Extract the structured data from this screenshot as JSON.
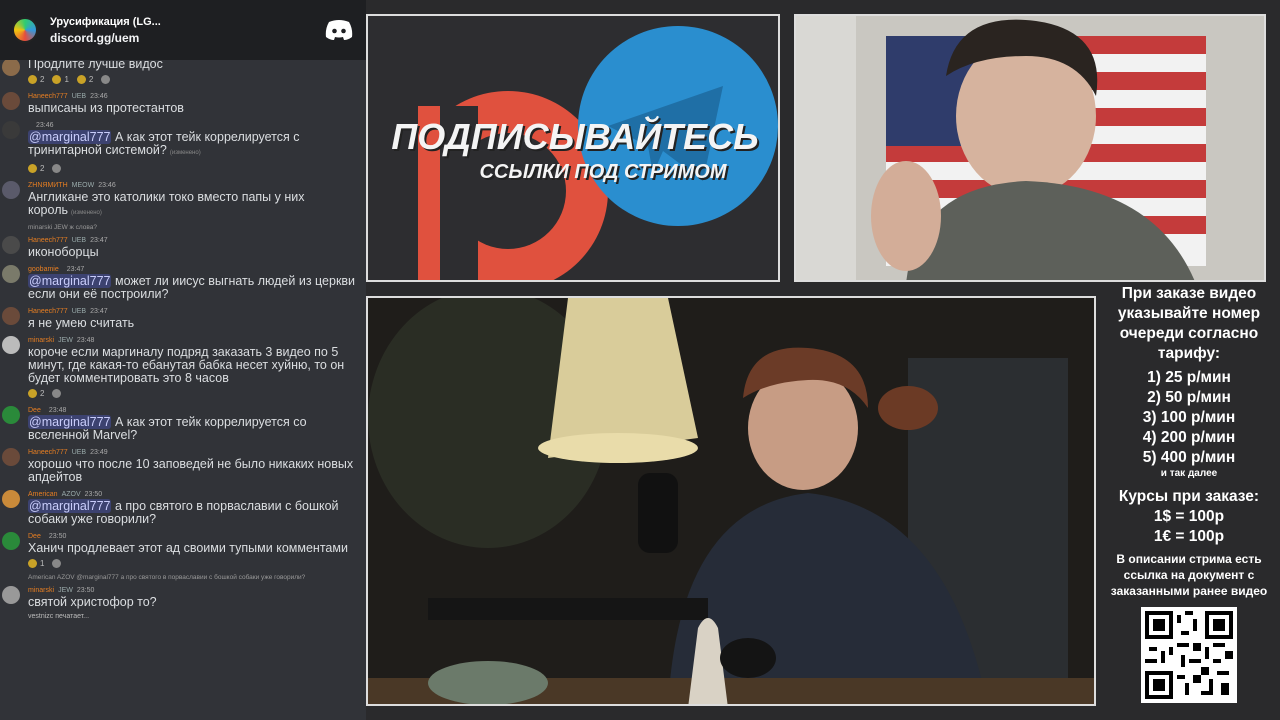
{
  "server": {
    "name": "Урусификация (LG...",
    "invite": "discord.gg/uem"
  },
  "messages": [
    {
      "user": "",
      "badges": "",
      "time": "",
      "text": "Продлите лучше видос",
      "reactions": [
        "2",
        "1",
        "2"
      ]
    },
    {
      "user": "Haneech777",
      "badges": "UEB",
      "time": "23:46",
      "text": "выписаны из протестантов",
      "reactions": []
    },
    {
      "user": "",
      "badges": "",
      "time": "23:46",
      "mention": "@marginal777",
      "text": "А как этот тейк коррелируется с тринитарной системой?",
      "edited": "(изменено)",
      "reactions": [
        "2"
      ]
    },
    {
      "user": "ZHNЯMИТН",
      "badges": "MEOW",
      "time": "23:46",
      "text": "Англикане это католики токо вместо папы у них король",
      "edited": "(изменено)",
      "reactions": []
    },
    {
      "reply": "minarski  JEW  ж слова?",
      "user": "Haneech777",
      "badges": "UEB",
      "time": "23:47",
      "text": "иконоборцы",
      "reactions": []
    },
    {
      "user": "goobamie",
      "badges": "",
      "time": "23:47",
      "mention": "@marginal777",
      "text": "может ли иисус выгнать людей из церкви если они её построили?",
      "reactions": []
    },
    {
      "user": "Haneech777",
      "badges": "UEB",
      "time": "23:47",
      "text": "я не умею считать",
      "reactions": []
    },
    {
      "user": "minarski",
      "badges": "JEW",
      "time": "23:48",
      "text": "короче если маргиналу подряд заказать 3 видео по 5 минут, где какая-то ебанутая бабка несет хуйню, то он будет комментировать это 8 часов",
      "reactions": [
        "2"
      ]
    },
    {
      "user": "Dee",
      "badges": "",
      "time": "23:48",
      "mention": "@marginal777",
      "text": "А как этот тейк коррелируется со вселенной Marvel?",
      "reactions": []
    },
    {
      "user": "Haneech777",
      "badges": "UEB",
      "time": "23:49",
      "text": "хорошо что после 10 заповедей не было никаких новых апдейтов",
      "reactions": []
    },
    {
      "user": "American",
      "badges": "AZOV",
      "time": "23:50",
      "mention": "@marginal777",
      "text": "а про святого в порваславии с бошкой собаки уже говорили?",
      "reactions": []
    },
    {
      "user": "Dee",
      "badges": "",
      "time": "23:50",
      "text": "Ханич продлевает этот ад своими тупыми комментами",
      "reactions": [
        "1"
      ]
    },
    {
      "reply": "American  AZOV  @marginal777 а про святого в порваславии с бошкой собаки уже говорили?",
      "user": "minarski",
      "badges": "JEW",
      "time": "23:50",
      "text": "святой христофор то?",
      "reactions": []
    }
  ],
  "typing": "vestnizc печатает...",
  "promo": {
    "title": "ПОДПИСЫВАЙТЕСЬ",
    "subtitle": "ССЫЛКИ ПОД СТРИМОМ"
  },
  "sidebar": {
    "heading": "При заказе видео указывайте номер очереди согласно тарифу:",
    "tariffs": [
      "1) 25 р/мин",
      "2) 50 р/мин",
      "3) 100 р/мин",
      "4) 200 р/мин",
      "5) 400 р/мин"
    ],
    "etc": "и так далее",
    "rates_title": "Курсы при заказе:",
    "rates": [
      "1$ = 100р",
      "1€ = 100р"
    ],
    "desc": "В описании стрима есть ссылка на документ с заказанными ранее видео"
  },
  "colors": {
    "chat_bg": "#313338",
    "mention_bg": "#3c4270",
    "telegram": "#2a8ecf",
    "patreon": "#e85b46"
  }
}
